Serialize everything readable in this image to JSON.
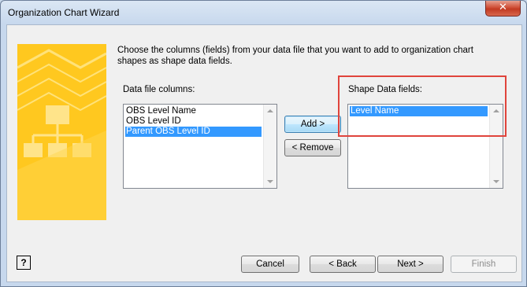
{
  "window": {
    "title": "Organization Chart Wizard",
    "close_label": "✕"
  },
  "instructions": "Choose the columns (fields) from your data file that you want to add to organization chart shapes as shape data fields.",
  "data_columns": {
    "label": "Data file columns:",
    "items": [
      "OBS Level Name",
      "OBS Level ID",
      "Parent OBS Level ID"
    ],
    "selected": "Parent OBS Level ID"
  },
  "shape_fields": {
    "label": "Shape Data fields:",
    "items": [
      "Level Name"
    ],
    "selected": "Level Name"
  },
  "buttons": {
    "add": "Add >",
    "remove": "< Remove",
    "cancel": "Cancel",
    "back": "< Back",
    "next": "Next >",
    "finish": "Finish",
    "help": "?"
  },
  "colors": {
    "accent_panel": "#ffc81f",
    "highlight_box": "#e0443c",
    "selection": "#3399ff"
  }
}
